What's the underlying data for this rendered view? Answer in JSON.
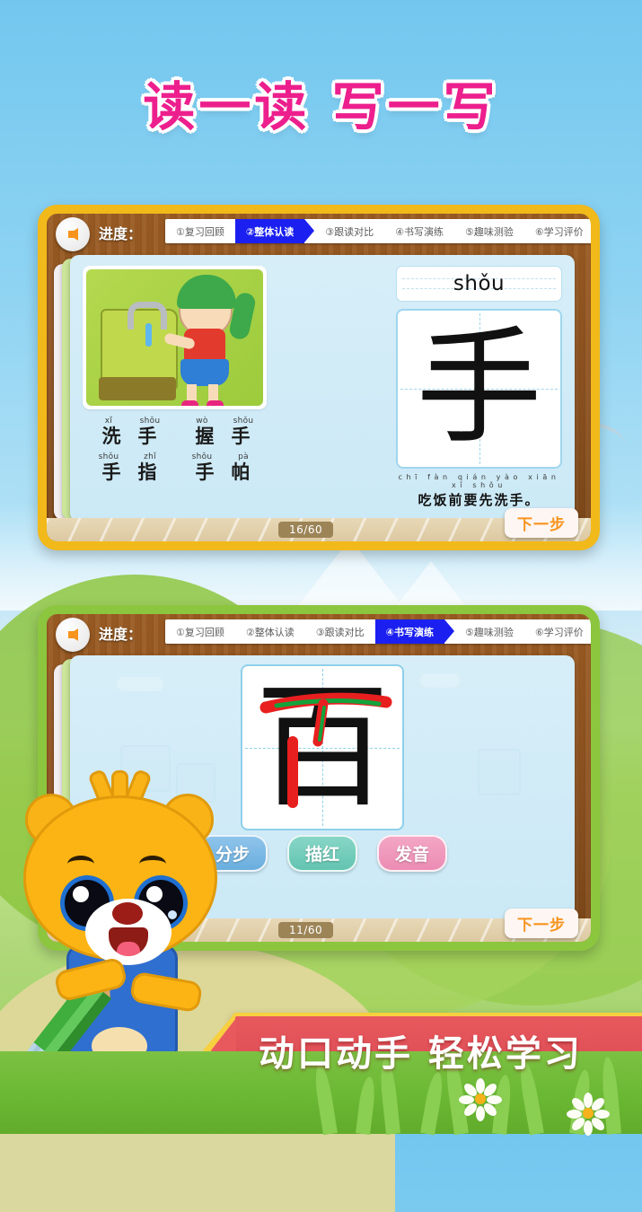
{
  "headline": "读一读 写一写",
  "panels": [
    {
      "id": "reading-panel",
      "progress_label": "进度：",
      "steps": [
        {
          "label": "①复习回顾",
          "active": false
        },
        {
          "label": "②整体认读",
          "active": true
        },
        {
          "label": "③跟读对比",
          "active": false
        },
        {
          "label": "④书写演练",
          "active": false
        },
        {
          "label": "⑤趣味测验",
          "active": false
        },
        {
          "label": "⑥学习评价",
          "active": false
        }
      ],
      "words": [
        {
          "pinyin": [
            "xǐ",
            "shǒu"
          ],
          "hanzi": [
            "洗",
            "手"
          ]
        },
        {
          "pinyin": [
            "wò",
            "shǒu"
          ],
          "hanzi": [
            "握",
            "手"
          ]
        },
        {
          "pinyin": [
            "shǒu",
            "zhǐ"
          ],
          "hanzi": [
            "手",
            "指"
          ]
        },
        {
          "pinyin": [
            "shǒu",
            "pà"
          ],
          "hanzi": [
            "手",
            "帕"
          ]
        }
      ],
      "character": "手",
      "character_pinyin": "shǒu",
      "sentence_pinyin": "chī fàn qián yào xiān xǐ shǒu",
      "sentence_hanzi": "吃饭前要先洗手。",
      "counter": "16/60",
      "next_label": "下一步",
      "frame_color": "#f2b91a"
    },
    {
      "id": "writing-panel",
      "progress_label": "进度：",
      "steps": [
        {
          "label": "①复习回顾",
          "active": false
        },
        {
          "label": "②整体认读",
          "active": false
        },
        {
          "label": "③跟读对比",
          "active": false
        },
        {
          "label": "④书写演练",
          "active": true
        },
        {
          "label": "⑤趣味测验",
          "active": false
        },
        {
          "label": "⑥学习评价",
          "active": false
        }
      ],
      "character": "百",
      "buttons": [
        {
          "label": "分步",
          "color": "#6aaede"
        },
        {
          "label": "描红",
          "color": "#63c4b1"
        },
        {
          "label": "发音",
          "color": "#ec8cb4"
        }
      ],
      "counter": "11/60",
      "next_label": "下一步",
      "frame_color": "#8cc63e"
    }
  ],
  "banner": "动口动手 轻松学习",
  "colors": {
    "headline": "#ec1f8d",
    "active_step": "#1b20f0",
    "banner_bg": "#e8595e",
    "banner_border": "#f7cf3f",
    "next_btn_text": "#f7941e"
  }
}
